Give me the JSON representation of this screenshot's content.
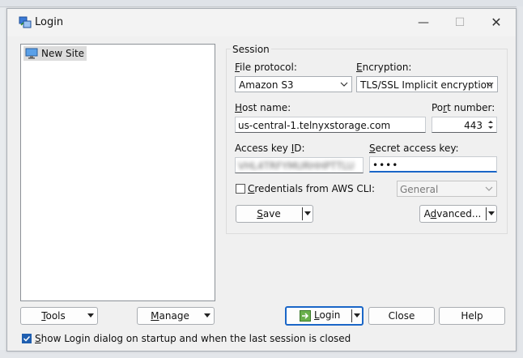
{
  "window": {
    "title": "Login",
    "minimize_glyph": "—",
    "maximize_glyph": "☐",
    "close_glyph": "✕"
  },
  "site_tree": {
    "items": [
      {
        "label": "New Site",
        "icon": "monitor-icon"
      }
    ]
  },
  "session": {
    "legend": "Session",
    "file_protocol": {
      "label_pre": "",
      "label_u": "F",
      "label_post": "ile protocol:",
      "value": "Amazon S3"
    },
    "encryption": {
      "label_pre": "",
      "label_u": "E",
      "label_post": "ncryption:",
      "value": "TLS/SSL Implicit encryption"
    },
    "host_name": {
      "label_pre": "",
      "label_u": "H",
      "label_post": "ost name:",
      "value": "us-central-1.telnyxstorage.com"
    },
    "port_number": {
      "label_pre": "Po",
      "label_u": "r",
      "label_post": "t number:",
      "value": "443"
    },
    "access_key_id": {
      "label_pre": "Access key ",
      "label_u": "I",
      "label_post": "D:",
      "value": "VHL4TRFYMURHHPTTLU"
    },
    "secret_access_key": {
      "label_pre": "",
      "label_u": "S",
      "label_post": "ecret access key:",
      "value": "••••"
    },
    "credentials_aws_cli": {
      "label_pre": "",
      "label_u": "C",
      "label_post": "redentials from AWS CLI:",
      "checked": false
    },
    "profile": {
      "value": "General"
    },
    "save_button": {
      "label_pre": "",
      "label_u": "S",
      "label_post": "ave"
    },
    "advanced_button": {
      "label_pre": "A",
      "label_u": "d",
      "label_post": "vanced..."
    }
  },
  "bottom": {
    "tools_button": {
      "label_pre": "",
      "label_u": "T",
      "label_post": "ools"
    },
    "manage_button": {
      "label_pre": "",
      "label_u": "M",
      "label_post": "anage"
    },
    "login_button": {
      "label_pre": "",
      "label_u": "L",
      "label_post": "ogin"
    },
    "close_button": "Close",
    "help_button": "Help",
    "show_login_check": {
      "label_pre": "",
      "label_u": "S",
      "label_post": "how Login dialog on startup and when the last session is closed",
      "checked": true
    }
  },
  "colors": {
    "accent": "#1a66c7",
    "dialog_bg": "#f0f0f0"
  }
}
